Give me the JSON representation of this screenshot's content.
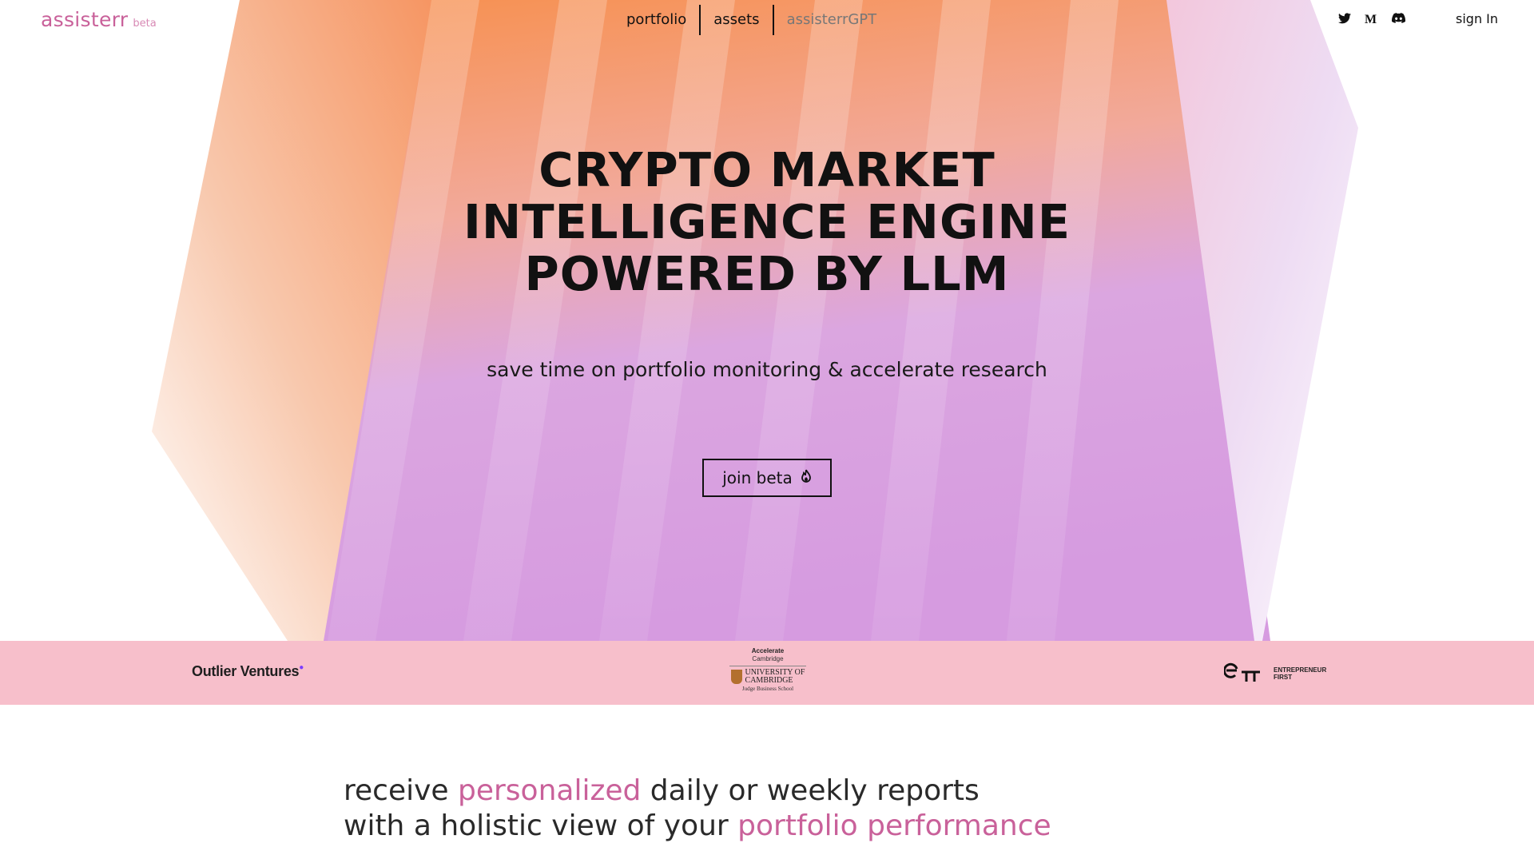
{
  "header": {
    "brand": "assisterr",
    "brand_badge": "beta",
    "nav": [
      {
        "label": "portfolio"
      },
      {
        "label": "assets"
      },
      {
        "label": "assisterrGPT"
      }
    ],
    "socials": [
      {
        "icon": "twitter-icon"
      },
      {
        "icon": "medium-icon"
      },
      {
        "icon": "discord-icon"
      }
    ],
    "sign_in": "sign In"
  },
  "hero": {
    "title_lines": [
      "CRYPTO MARKET",
      "INTELLIGENCE ENGINE",
      "POWERED BY LLM"
    ],
    "subtitle": "save time on portfolio monitoring & accelerate research",
    "cta": {
      "label": "join beta",
      "icon": "fire-icon"
    }
  },
  "partners": {
    "outlier": "Outlier Ventures",
    "cambridge": {
      "accelerate": "Accelerate",
      "cambridge": "Cambridge",
      "university_line1": "UNIVERSITY OF",
      "university_line2": "CAMBRIDGE",
      "school": "Judge Business School"
    },
    "ef": {
      "line1": "ENTREPRENEUR",
      "line2": "FIRST"
    }
  },
  "lower": {
    "line1": {
      "pre": "receive ",
      "highlight": "personalized",
      "post": " daily or weekly reports"
    },
    "line2": {
      "pre": "with a holistic view of your ",
      "highlight": "portfolio performance"
    }
  },
  "colors": {
    "brand": "#c9619a",
    "partner_band": "#f7bfcb",
    "orange": "#f58a5c",
    "lilac": "#d69be0"
  }
}
